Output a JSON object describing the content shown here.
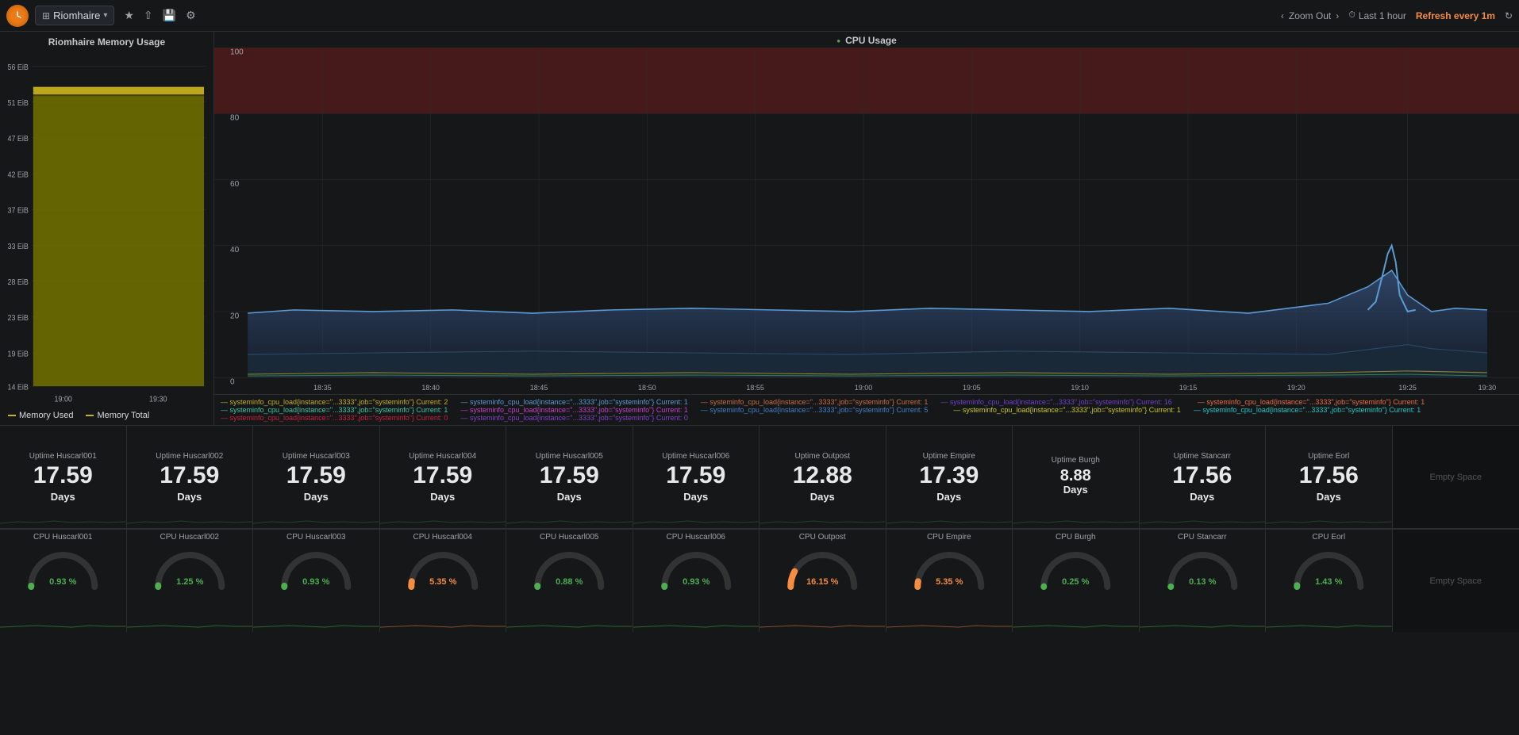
{
  "topnav": {
    "logo": "G",
    "dashboard_name": "Riomhaire",
    "zoom_out_label": "Zoom Out",
    "time_range_label": "Last 1 hour",
    "refresh_label": "Refresh every 1m",
    "icons": {
      "star": "★",
      "share": "⇧",
      "save": "💾",
      "settings": "⚙"
    }
  },
  "memory_panel": {
    "title": "Riomhaire Memory Usage",
    "y_labels": [
      "56 EiB",
      "51 EiB",
      "47 EiB",
      "42 EiB",
      "37 EiB",
      "33 EiB",
      "28 EiB",
      "23 EiB",
      "19 EiB",
      "14 EiB"
    ],
    "x_labels": [
      "19:00",
      "19:30"
    ],
    "legend": [
      {
        "label": "Memory Used",
        "color": "#c8b020"
      },
      {
        "label": "Memory Total",
        "color": "#c8b020"
      }
    ]
  },
  "cpu_panel": {
    "title": "CPU Usage",
    "title_dot_color": "#4caf50",
    "y_labels": [
      "100",
      "80",
      "60",
      "40",
      "20",
      "0"
    ],
    "x_labels": [
      "18:35",
      "18:40",
      "18:45",
      "18:50",
      "18:55",
      "19:00",
      "19:05",
      "19:10",
      "19:15",
      "19:20",
      "19:25",
      "19:30"
    ]
  },
  "uptime_stats": [
    {
      "label": "Uptime Huscarl001",
      "value": "17.59",
      "unit": "Days"
    },
    {
      "label": "Uptime Huscarl002",
      "value": "17.59",
      "unit": "Days"
    },
    {
      "label": "Uptime Huscarl003",
      "value": "17.59",
      "unit": "Days"
    },
    {
      "label": "Uptime Huscarl004",
      "value": "17.59",
      "unit": "Days"
    },
    {
      "label": "Uptime Huscarl005",
      "value": "17.59",
      "unit": "Days"
    },
    {
      "label": "Uptime Huscarl006",
      "value": "17.59",
      "unit": "Days"
    },
    {
      "label": "Uptime Outpost",
      "value": "12.88",
      "unit": "Days"
    },
    {
      "label": "Uptime Empire",
      "value": "17.39",
      "unit": "Days"
    },
    {
      "label": "Uptime Burgh",
      "value": "8.88",
      "unit": "Days"
    },
    {
      "label": "Uptime Stancarr",
      "value": "17.56",
      "unit": "Days"
    },
    {
      "label": "Uptime Eorl",
      "value": "17.56",
      "unit": "Days"
    },
    {
      "label": "empty",
      "value": "",
      "unit": "Empty Space"
    }
  ],
  "cpu_stats": [
    {
      "label": "CPU Huscarl001",
      "value": "0.93 %",
      "color": "#4caf50"
    },
    {
      "label": "CPU Huscarl002",
      "value": "1.25 %",
      "color": "#4caf50"
    },
    {
      "label": "CPU Huscarl003",
      "value": "0.93 %",
      "color": "#4caf50"
    },
    {
      "label": "CPU Huscarl004",
      "value": "5.35 %",
      "color": "#f58c40"
    },
    {
      "label": "CPU Huscarl005",
      "value": "0.88 %",
      "color": "#4caf50"
    },
    {
      "label": "CPU Huscarl006",
      "value": "0.93 %",
      "color": "#4caf50"
    },
    {
      "label": "CPU Outpost",
      "value": "16.15 %",
      "color": "#f58c40"
    },
    {
      "label": "CPU Empire",
      "value": "5.35 %",
      "color": "#f58c40"
    },
    {
      "label": "CPU Burgh",
      "value": "0.25 %",
      "color": "#4caf50"
    },
    {
      "label": "CPU Stancarr",
      "value": "0.13 %",
      "color": "#4caf50"
    },
    {
      "label": "CPU Eorl",
      "value": "1.43 %",
      "color": "#4caf50"
    },
    {
      "label": "empty",
      "value": "",
      "unit": "Empty Space"
    }
  ],
  "colors": {
    "bg_dark": "#161719",
    "bg_panel": "#111214",
    "border": "#2c2e30",
    "accent_orange": "#f58c40",
    "accent_green": "#4caf50",
    "cpu_chart_red_zone": "rgba(180,40,40,0.35)",
    "cpu_line_blue": "#5b9bd5",
    "cpu_line_yellow": "#e8c350",
    "cpu_line_green": "#4caf50",
    "memory_bar": "#8b8b00",
    "memory_total": "#c8b020"
  }
}
